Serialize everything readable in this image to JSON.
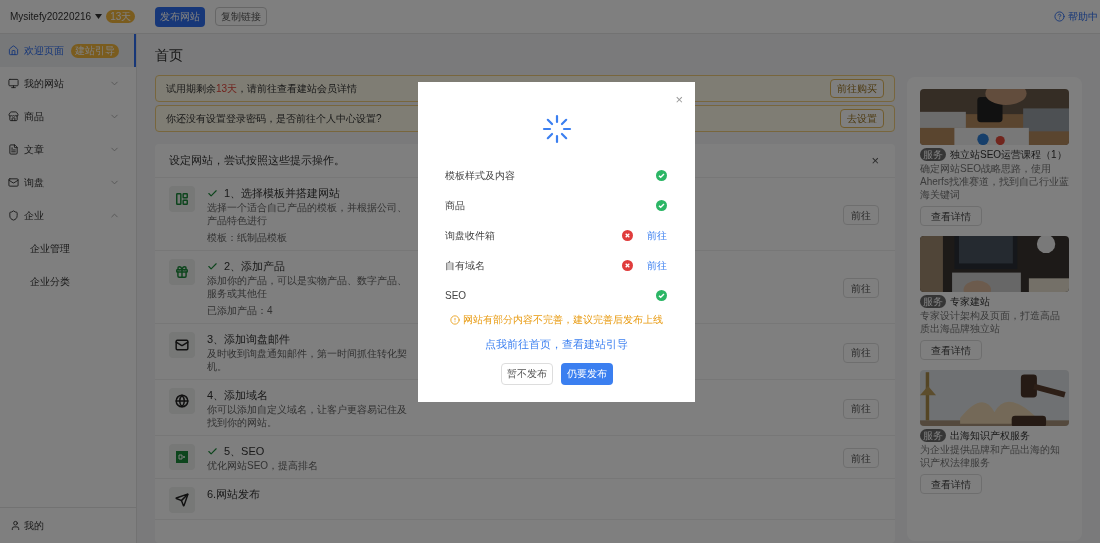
{
  "topbar": {
    "site_name": "Mysitefy20220216",
    "days_badge": "13天",
    "publish_button": "发布网站",
    "copy_link_button": "复制链接",
    "help": "帮助中"
  },
  "sidebar": {
    "items": [
      {
        "label": "欢迎页面",
        "badge": "建站引导",
        "selected": true
      },
      {
        "label": "我的网站",
        "selected": false,
        "expanded": false
      },
      {
        "label": "商品",
        "selected": false,
        "expanded": false
      },
      {
        "label": "文章",
        "selected": false,
        "expanded": false
      },
      {
        "label": "询盘",
        "selected": false,
        "expanded": false
      },
      {
        "label": "企业",
        "selected": false,
        "expanded": true,
        "children": [
          {
            "label": "企业管理",
            "selected": false
          },
          {
            "label": "企业分类",
            "selected": false
          }
        ]
      }
    ],
    "footer": "我的"
  },
  "page_title": "首页",
  "notices": [
    {
      "before": "试用期剩余",
      "highlight": "13天",
      "after": "，请前往查看建站会员详情",
      "button": "前往购买"
    },
    {
      "before": "你还没有设置登录密码，是否前往个人中心设置?",
      "button": "去设置"
    }
  ],
  "steps_card": {
    "heading": "设定网站，尝试按照这些提示操作。",
    "close": "×",
    "steps": [
      {
        "done": true,
        "title": "1、选择模板并搭建网站",
        "description": "选择一个适合自己产品的模板，并根据公司、产品特色进行",
        "extra": "模板：纸制品模板",
        "button": "前往"
      },
      {
        "done": true,
        "title": "2、添加产品",
        "description": "添加你的产品，可以是实物产品、数字产品、服务或其他任",
        "extra": "已添加产品：4",
        "button": "前往"
      },
      {
        "done": false,
        "title": "3、添加询盘邮件",
        "description": "及时收到询盘通知邮件，第一时间抓住转化契机。",
        "button": "前往"
      },
      {
        "done": false,
        "title": "4、添加域名",
        "description": "你可以添加自定义域名，让客户更容易记住及找到你的网站。",
        "button": "前往"
      },
      {
        "done": true,
        "title": "5、SEO",
        "description": "优化网站SEO，提高排名",
        "button": "前往"
      },
      {
        "done": false,
        "title": "6.网站发布"
      }
    ]
  },
  "promo_cards": [
    {
      "badge": "服务",
      "title": "独立站SEO运营课程（1）",
      "description": "确定网站SEO战略思路，使用Aherfs找准赛道，找到自己行业蓝海关键词",
      "button": "查看详情"
    },
    {
      "badge": "服务",
      "title": "专家建站",
      "description": "专家设计架构及页面，打造高品质出海品牌独立站",
      "button": "查看详情"
    },
    {
      "badge": "服务",
      "title": "出海知识产权服务",
      "description": "为企业提供品牌和产品出海的知识产权法律服务",
      "button": "查看详情"
    }
  ],
  "dialog": {
    "close": "×",
    "checks": [
      {
        "label": "模板样式及内容",
        "ok": true
      },
      {
        "label": "商品",
        "ok": true
      },
      {
        "label": "询盘收件箱",
        "ok": false,
        "link": "前往"
      },
      {
        "label": "自有域名",
        "ok": false,
        "link": "前往"
      },
      {
        "label": "SEO",
        "ok": true
      }
    ],
    "warning": "网站有部分内容不完善，建议完善后发布上线",
    "guide_link": "点我前往首页，查看建站引导",
    "cancel_button": "暂不发布",
    "confirm_button": "仍要发布"
  }
}
